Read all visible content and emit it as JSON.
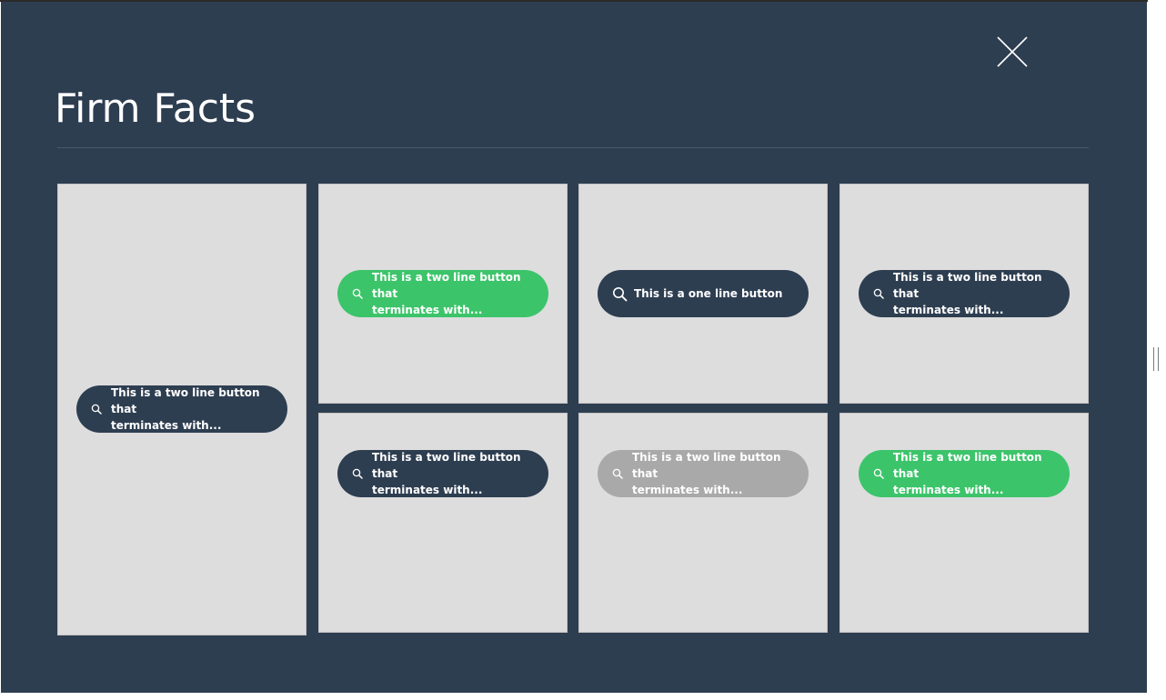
{
  "modal": {
    "title": "Firm Facts",
    "close_icon": "close-icon"
  },
  "colors": {
    "background": "#2e3e51",
    "tile": "#dddddd",
    "button_dark": "#2e3e51",
    "button_green": "#3cc46a",
    "button_gray": "#a9a9a9"
  },
  "tiles": [
    {
      "button": {
        "label": "This is a two line button that\nterminates with...",
        "style": "dark",
        "icon": "search-icon"
      }
    },
    {
      "button": {
        "label": "This is a two line button that\nterminates with...",
        "style": "green",
        "icon": "search-icon"
      }
    },
    {
      "button": {
        "label": "This is a one line button",
        "style": "dark",
        "icon": "search-icon"
      }
    },
    {
      "button": {
        "label": "This is a two line button that\nterminates with...",
        "style": "dark",
        "icon": "search-icon"
      }
    },
    {
      "button": {
        "label": "This is a two line button that\nterminates with...",
        "style": "dark",
        "icon": "search-icon"
      }
    },
    {
      "button": {
        "label": "This is a two line button that\nterminates with...",
        "style": "gray",
        "icon": "search-icon"
      }
    },
    {
      "button": {
        "label": "This is a two line button that\nterminates with...",
        "style": "green",
        "icon": "search-icon"
      }
    }
  ]
}
